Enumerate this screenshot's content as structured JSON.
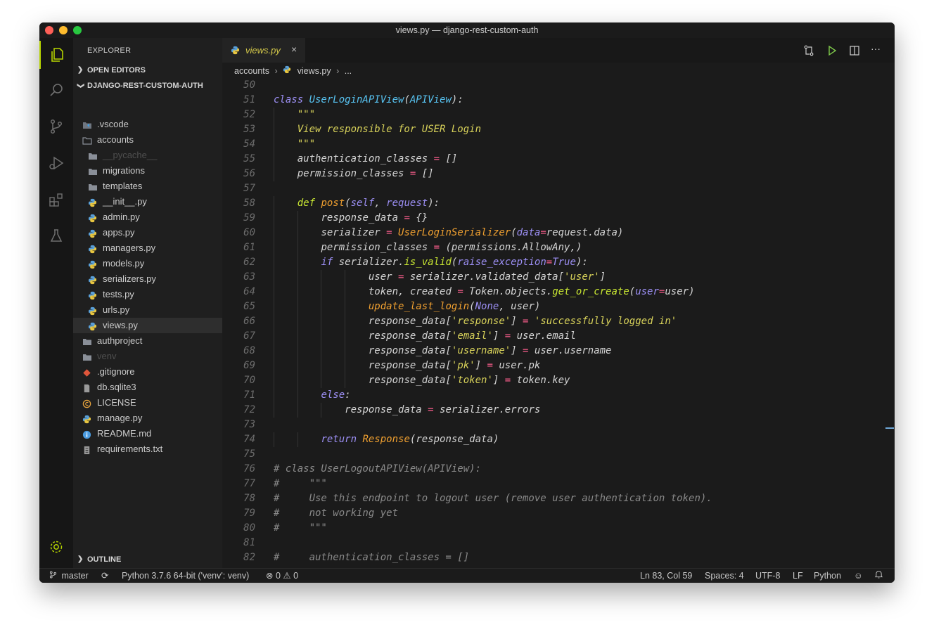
{
  "window": {
    "title": "views.py — django-rest-custom-auth"
  },
  "sidebar": {
    "title": "EXPLORER",
    "open_editors": "OPEN EDITORS",
    "project": "DJANGO-REST-CUSTOM-AUTH",
    "outline": "OUTLINE",
    "tree": [
      {
        "name": ".vscode",
        "icon": "vscode-folder-icon",
        "level": 1
      },
      {
        "name": "accounts",
        "icon": "folder-open-icon",
        "level": 1
      },
      {
        "name": "__pycache__",
        "icon": "folder-icon",
        "level": 2,
        "dim": true
      },
      {
        "name": "migrations",
        "icon": "folder-icon",
        "level": 2
      },
      {
        "name": "templates",
        "icon": "folder-icon",
        "level": 2
      },
      {
        "name": "__init__.py",
        "icon": "python-icon",
        "level": 2
      },
      {
        "name": "admin.py",
        "icon": "python-icon",
        "level": 2
      },
      {
        "name": "apps.py",
        "icon": "python-icon",
        "level": 2
      },
      {
        "name": "managers.py",
        "icon": "python-icon",
        "level": 2
      },
      {
        "name": "models.py",
        "icon": "python-icon",
        "level": 2
      },
      {
        "name": "serializers.py",
        "icon": "python-icon",
        "level": 2
      },
      {
        "name": "tests.py",
        "icon": "python-icon",
        "level": 2
      },
      {
        "name": "urls.py",
        "icon": "python-icon",
        "level": 2
      },
      {
        "name": "views.py",
        "icon": "python-icon",
        "level": 2,
        "selected": true
      },
      {
        "name": "authproject",
        "icon": "folder-icon",
        "level": 1
      },
      {
        "name": "venv",
        "icon": "folder-icon",
        "level": 1,
        "dim": true
      },
      {
        "name": ".gitignore",
        "icon": "git-icon",
        "level": 1
      },
      {
        "name": "db.sqlite3",
        "icon": "file-icon",
        "level": 1
      },
      {
        "name": "LICENSE",
        "icon": "license-icon",
        "level": 1
      },
      {
        "name": "manage.py",
        "icon": "python-icon",
        "level": 1
      },
      {
        "name": "README.md",
        "icon": "info-icon",
        "level": 1
      },
      {
        "name": "requirements.txt",
        "icon": "list-file-icon",
        "level": 1
      }
    ]
  },
  "tab": {
    "label": "views.py",
    "close": "×"
  },
  "breadcrumb": {
    "folder": "accounts",
    "file": "views.py",
    "more": "..."
  },
  "code": {
    "lines": [
      {
        "n": "50",
        "indent": 0,
        "t": []
      },
      {
        "n": "51",
        "indent": 0,
        "t": [
          [
            "kw",
            "class "
          ],
          [
            "cls",
            "UserLoginAPIView"
          ],
          [
            "var",
            "("
          ],
          [
            "cls",
            "APIView"
          ],
          [
            "var",
            "):"
          ]
        ]
      },
      {
        "n": "52",
        "indent": 1,
        "t": [
          [
            "str",
            "\"\"\""
          ]
        ]
      },
      {
        "n": "53",
        "indent": 1,
        "t": [
          [
            "str",
            "View responsible for USER Login"
          ]
        ]
      },
      {
        "n": "54",
        "indent": 1,
        "t": [
          [
            "str",
            "\"\"\""
          ]
        ]
      },
      {
        "n": "55",
        "indent": 1,
        "t": [
          [
            "var",
            "authentication_classes "
          ],
          [
            "op",
            "="
          ],
          [
            "var",
            " []"
          ]
        ]
      },
      {
        "n": "56",
        "indent": 1,
        "t": [
          [
            "var",
            "permission_classes "
          ],
          [
            "op",
            "="
          ],
          [
            "var",
            " []"
          ]
        ]
      },
      {
        "n": "57",
        "indent": 0,
        "t": []
      },
      {
        "n": "58",
        "indent": 1,
        "t": [
          [
            "kw2",
            "def "
          ],
          [
            "fn",
            "post"
          ],
          [
            "var",
            "("
          ],
          [
            "pr",
            "self"
          ],
          [
            "var",
            ", "
          ],
          [
            "pr",
            "request"
          ],
          [
            "var",
            "):"
          ]
        ]
      },
      {
        "n": "59",
        "indent": 2,
        "t": [
          [
            "var",
            "response_data "
          ],
          [
            "op",
            "="
          ],
          [
            "var",
            " {}"
          ]
        ]
      },
      {
        "n": "60",
        "indent": 2,
        "t": [
          [
            "var",
            "serializer "
          ],
          [
            "op",
            "="
          ],
          [
            "var",
            " "
          ],
          [
            "fn",
            "UserLoginSerializer"
          ],
          [
            "var",
            "("
          ],
          [
            "pr",
            "data"
          ],
          [
            "op",
            "="
          ],
          [
            "var",
            "request.data)"
          ]
        ]
      },
      {
        "n": "61",
        "indent": 2,
        "t": [
          [
            "var",
            "permission_classes "
          ],
          [
            "op",
            "="
          ],
          [
            "var",
            " (permissions.AllowAny,)"
          ]
        ]
      },
      {
        "n": "62",
        "indent": 2,
        "t": [
          [
            "kw",
            "if "
          ],
          [
            "var",
            "serializer."
          ],
          [
            "kw2",
            "is_valid"
          ],
          [
            "var",
            "("
          ],
          [
            "pr",
            "raise_exception"
          ],
          [
            "op",
            "="
          ],
          [
            "nn",
            "True"
          ],
          [
            "var",
            "):"
          ]
        ]
      },
      {
        "n": "63",
        "indent": 4,
        "t": [
          [
            "var",
            "user "
          ],
          [
            "op",
            "="
          ],
          [
            "var",
            " serializer.validated_data["
          ],
          [
            "str",
            "'user'"
          ],
          [
            "var",
            "]"
          ]
        ]
      },
      {
        "n": "64",
        "indent": 4,
        "t": [
          [
            "var",
            "token, created "
          ],
          [
            "op",
            "="
          ],
          [
            "var",
            " Token.objects."
          ],
          [
            "kw2",
            "get_or_create"
          ],
          [
            "var",
            "("
          ],
          [
            "pr",
            "user"
          ],
          [
            "op",
            "="
          ],
          [
            "var",
            "user)"
          ]
        ]
      },
      {
        "n": "65",
        "indent": 4,
        "t": [
          [
            "fn",
            "update_last_login"
          ],
          [
            "var",
            "("
          ],
          [
            "nn",
            "None"
          ],
          [
            "var",
            ", user)"
          ]
        ]
      },
      {
        "n": "66",
        "indent": 4,
        "t": [
          [
            "var",
            "response_data["
          ],
          [
            "str",
            "'response'"
          ],
          [
            "var",
            "] "
          ],
          [
            "op",
            "="
          ],
          [
            "var",
            " "
          ],
          [
            "str",
            "'successfully logged in'"
          ]
        ]
      },
      {
        "n": "67",
        "indent": 4,
        "t": [
          [
            "var",
            "response_data["
          ],
          [
            "str",
            "'email'"
          ],
          [
            "var",
            "] "
          ],
          [
            "op",
            "="
          ],
          [
            "var",
            " user.email"
          ]
        ]
      },
      {
        "n": "68",
        "indent": 4,
        "t": [
          [
            "var",
            "response_data["
          ],
          [
            "str",
            "'username'"
          ],
          [
            "var",
            "] "
          ],
          [
            "op",
            "="
          ],
          [
            "var",
            " user.username"
          ]
        ]
      },
      {
        "n": "69",
        "indent": 4,
        "t": [
          [
            "var",
            "response_data["
          ],
          [
            "str",
            "'pk'"
          ],
          [
            "var",
            "] "
          ],
          [
            "op",
            "="
          ],
          [
            "var",
            " user.pk"
          ]
        ]
      },
      {
        "n": "70",
        "indent": 4,
        "t": [
          [
            "var",
            "response_data["
          ],
          [
            "str",
            "'token'"
          ],
          [
            "var",
            "] "
          ],
          [
            "op",
            "="
          ],
          [
            "var",
            " token.key"
          ]
        ]
      },
      {
        "n": "71",
        "indent": 2,
        "t": [
          [
            "kw",
            "else"
          ],
          [
            "var",
            ":"
          ]
        ]
      },
      {
        "n": "72",
        "indent": 3,
        "t": [
          [
            "var",
            "response_data "
          ],
          [
            "op",
            "="
          ],
          [
            "var",
            " serializer.errors"
          ]
        ]
      },
      {
        "n": "73",
        "indent": 0,
        "t": []
      },
      {
        "n": "74",
        "indent": 2,
        "t": [
          [
            "kw",
            "return "
          ],
          [
            "fn",
            "Response"
          ],
          [
            "var",
            "(response_data)"
          ]
        ]
      },
      {
        "n": "75",
        "indent": 0,
        "t": []
      },
      {
        "n": "76",
        "indent": 0,
        "t": [
          [
            "cm",
            "# class UserLogoutAPIView(APIView):"
          ]
        ]
      },
      {
        "n": "77",
        "indent": 0,
        "t": [
          [
            "cm",
            "#     \"\"\""
          ]
        ]
      },
      {
        "n": "78",
        "indent": 0,
        "t": [
          [
            "cm",
            "#     Use this endpoint to logout user (remove user authentication token)."
          ]
        ]
      },
      {
        "n": "79",
        "indent": 0,
        "t": [
          [
            "cm",
            "#     not working yet"
          ]
        ]
      },
      {
        "n": "80",
        "indent": 0,
        "t": [
          [
            "cm",
            "#     \"\"\""
          ]
        ]
      },
      {
        "n": "81",
        "indent": 0,
        "t": []
      },
      {
        "n": "82",
        "indent": 0,
        "t": [
          [
            "cm",
            "#     authentication_classes = []"
          ]
        ]
      }
    ]
  },
  "status": {
    "branch": "master",
    "interpreter": "Python 3.7.6 64-bit ('venv': venv)",
    "errors": "0",
    "warnings": "0",
    "position": "Ln 83, Col 59",
    "spaces": "Spaces: 4",
    "encoding": "UTF-8",
    "eol": "LF",
    "language": "Python"
  },
  "colors": {
    "accent": "#b5d300",
    "background": "#1b1b1b",
    "sidebar": "#1f1f1f"
  }
}
